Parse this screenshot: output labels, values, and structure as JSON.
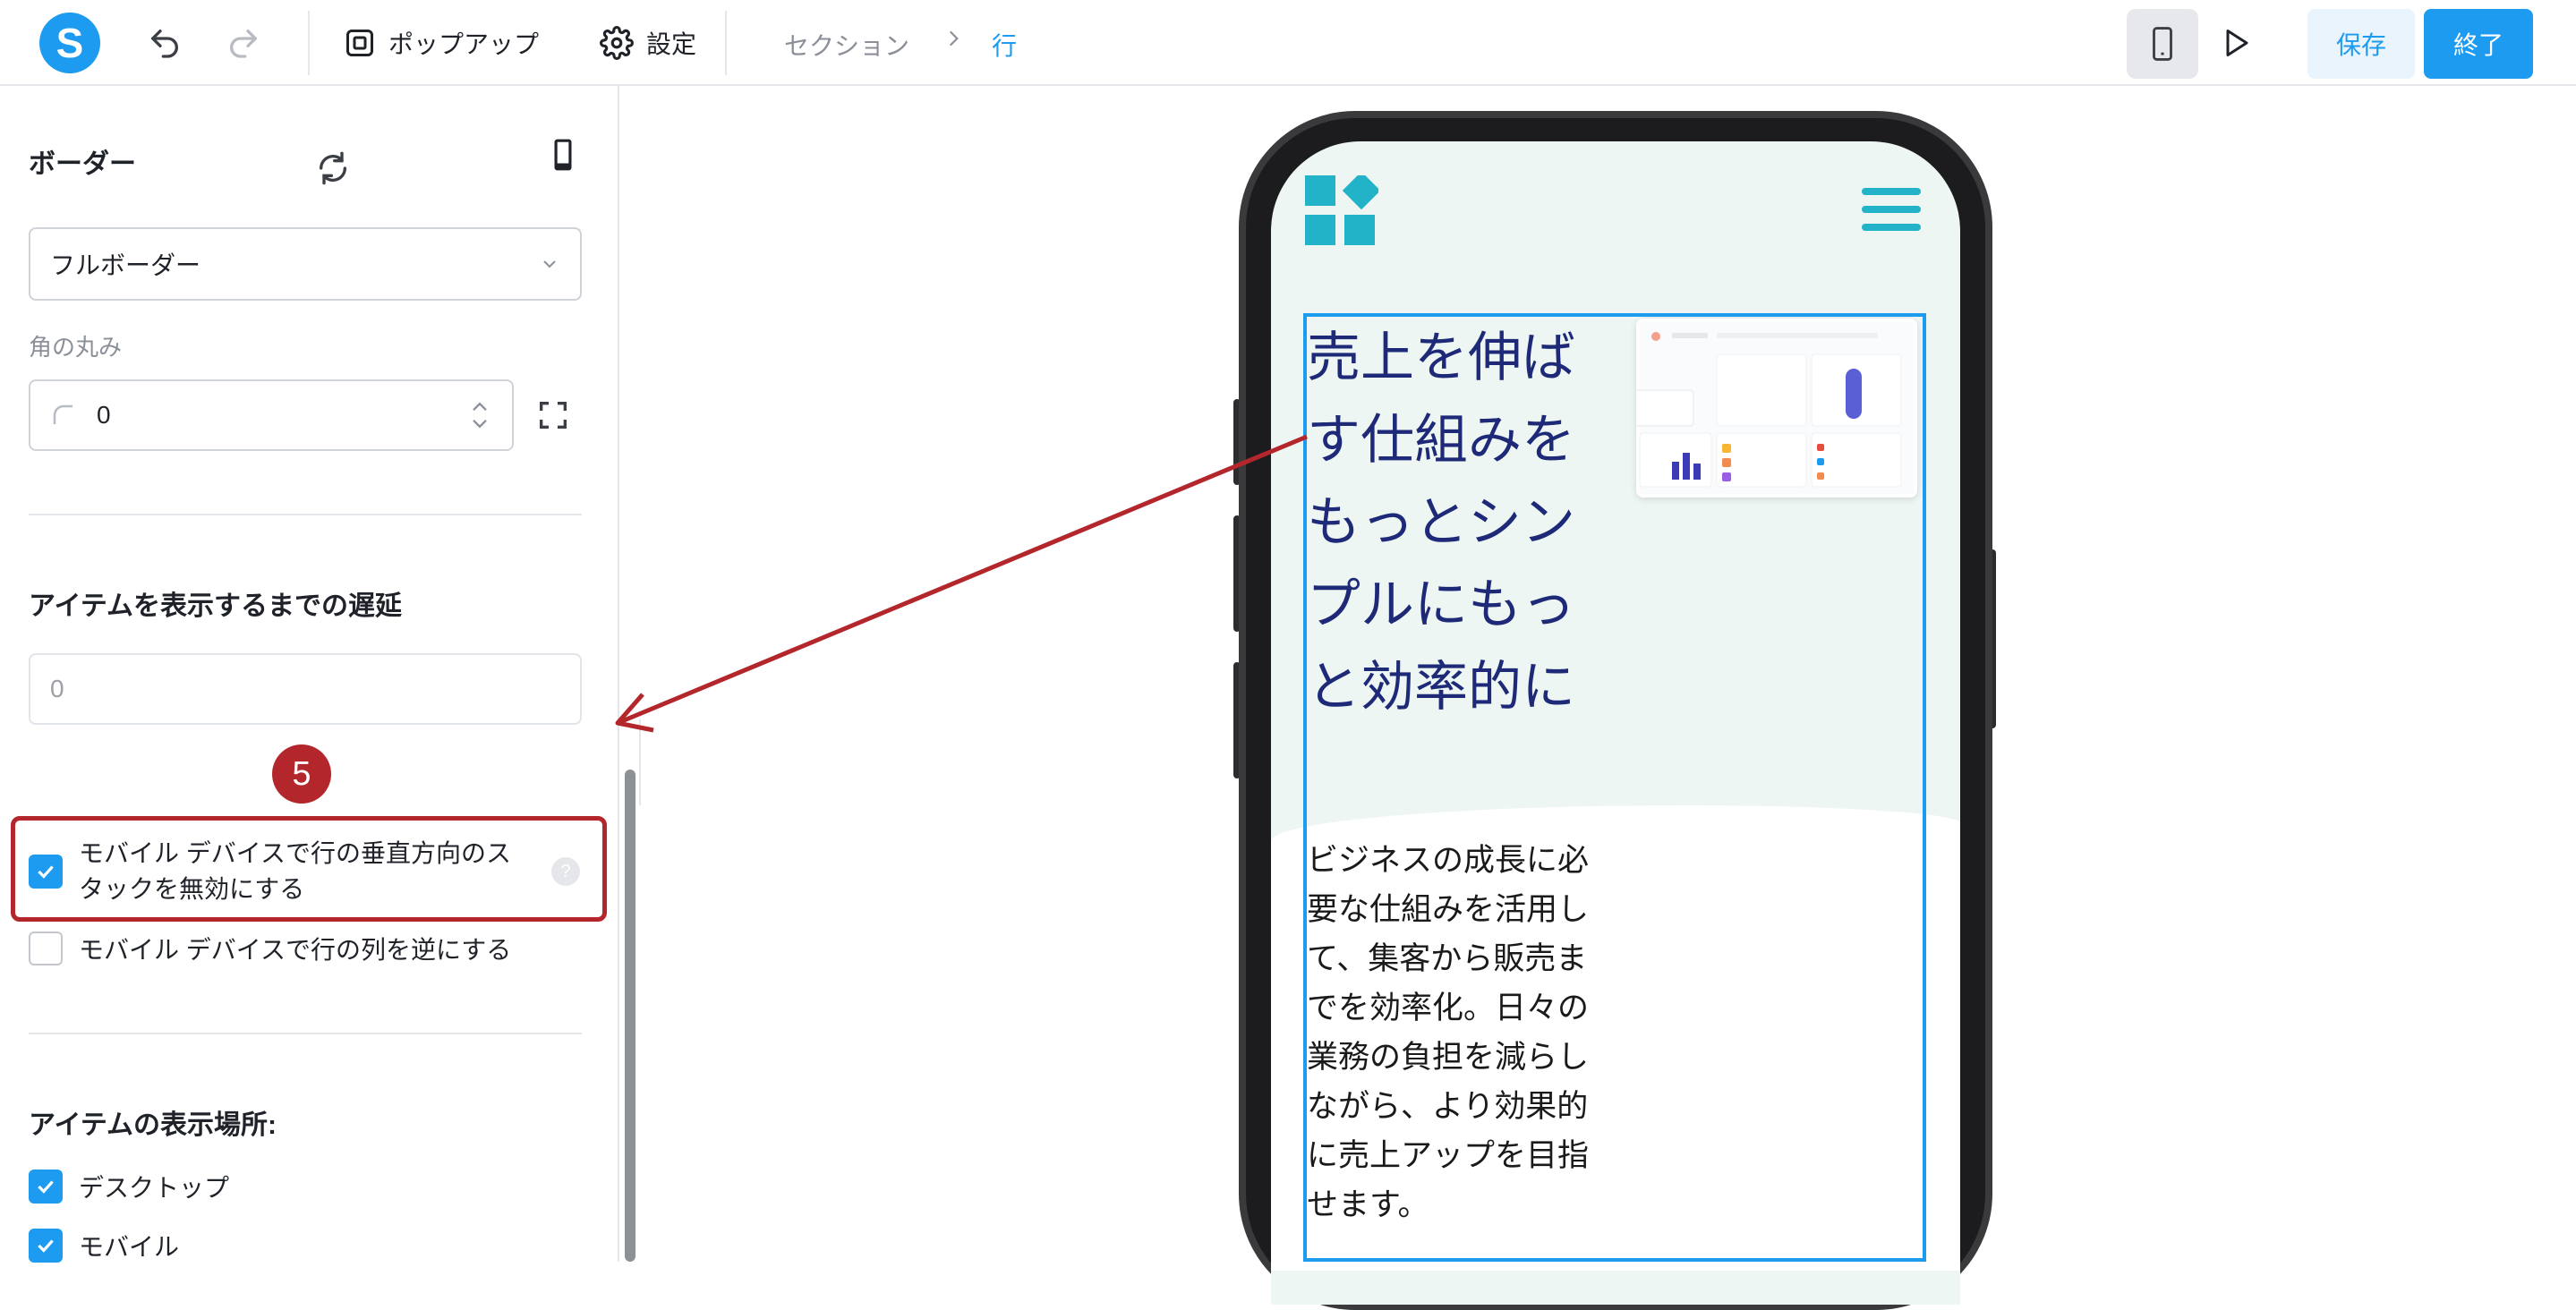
{
  "toolbar": {
    "logo_letter": "S",
    "popup_label": "ポップアップ",
    "settings_label": "設定",
    "breadcrumb": [
      "セクション",
      "行"
    ],
    "save_label": "保存",
    "done_label": "終了"
  },
  "panel": {
    "border_title": "ボーダー",
    "border_select_value": "フルボーダー",
    "corner_label": "角の丸み",
    "corner_value": "0",
    "delay_title": "アイテムを表示するまでの遅延",
    "delay_placeholder": "0",
    "badge_number": "5",
    "checkbox_disable_stack": "モバイル デバイスで行の垂直方向のスタックを無効にする",
    "checkbox_disable_stack_checked": true,
    "checkbox_reverse_columns": "モバイル デバイスで行の列を逆にする",
    "checkbox_reverse_columns_checked": false,
    "display_title": "アイテムの表示場所:",
    "display_desktop": "デスクトップ",
    "display_desktop_checked": true,
    "display_mobile": "モバイル",
    "display_mobile_checked": true
  },
  "preview": {
    "hero_title": "売上を伸ばす仕組みをもっとシンプルにもっと効率的に",
    "hero_body": "ビジネスの成長に必要な仕組みを活用して、集客から販売までを効率化。日々の業務の負担を減らしながら、より効果的に売上アップを目指せます。"
  },
  "colors": {
    "accent": "#1d9bf0",
    "annotation": "#b3272c",
    "hero_text": "#1e2a78",
    "brand_teal": "#22b3c8"
  }
}
